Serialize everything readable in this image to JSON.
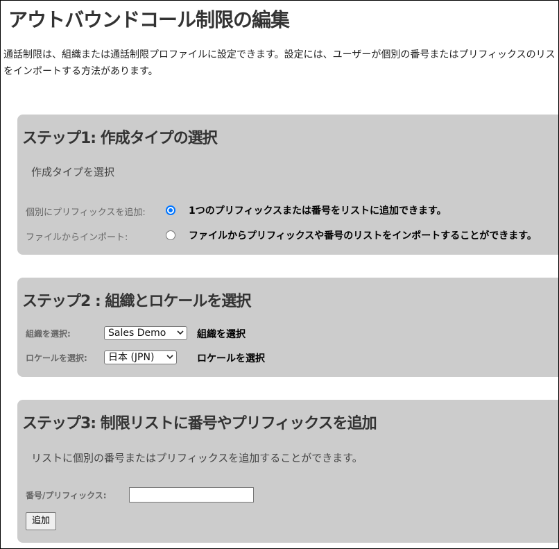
{
  "page": {
    "title": "アウトバウンドコール制限の編集",
    "intro": "通話制限は、組織または通話制限プロファイルに設定できます。設定には、ユーザーが個別の番号またはプリフィックスのリストをインポートする方法があります。"
  },
  "step1": {
    "heading": "ステップ1: 作成タイプの選択",
    "subtext": "作成タイプを選択",
    "options": [
      {
        "label": "個別にプリフィックスを追加:",
        "description": "1つのプリフィックスまたは番号をリストに追加できます。",
        "selected": true
      },
      {
        "label": "ファイルからインポート:",
        "description": "ファイルからプリフィックスや番号のリストをインポートすることができます。",
        "selected": false
      }
    ]
  },
  "step2": {
    "heading": "ステップ2 : 組織とロケールを選択",
    "org": {
      "label": "組織を選択:",
      "value": "Sales Demo",
      "hint": "組織を選択"
    },
    "locale": {
      "label": "ロケールを選択:",
      "value": "日本 (JPN)",
      "hint": "ロケールを選択"
    }
  },
  "step3": {
    "heading": "ステップ3: 制限リストに番号やプリフィックスを追加",
    "subtext": "リストに個別の番号またはプリフィックスを追加することができます。",
    "number_label": "番号/プリフィックス:",
    "number_value": "",
    "add_button": "追加"
  },
  "icons": {
    "select_arrow": "chevron-down-icon"
  }
}
